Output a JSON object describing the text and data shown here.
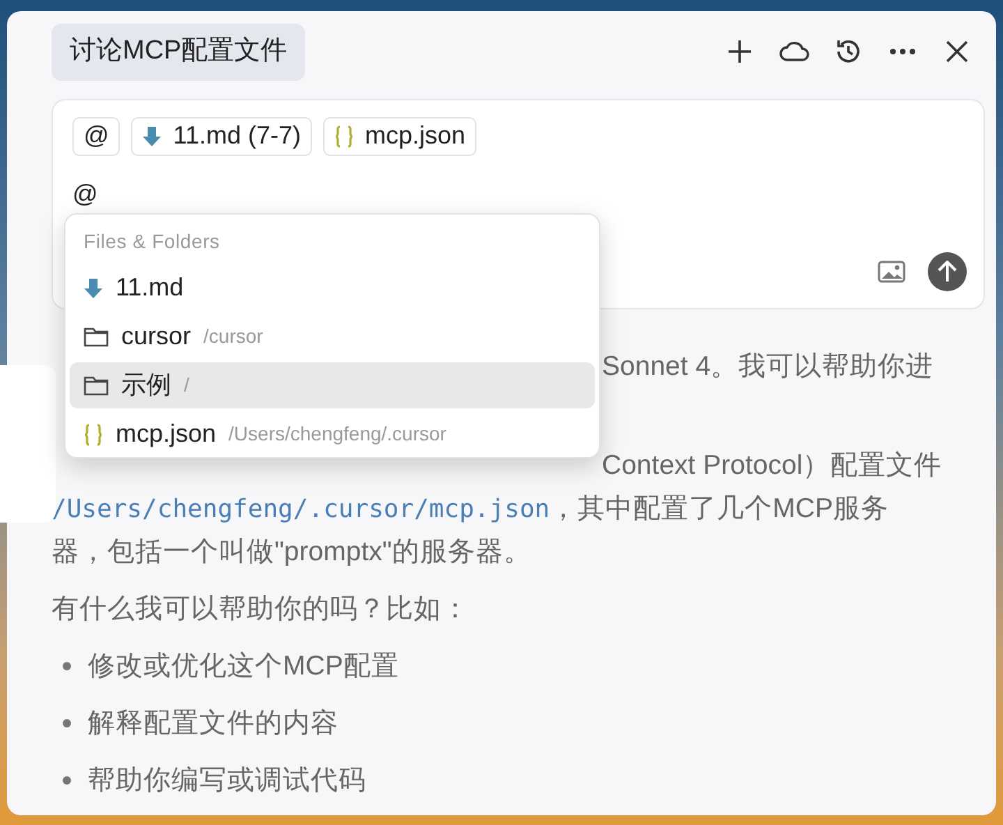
{
  "header": {
    "title": "讨论MCP配置文件"
  },
  "composer": {
    "mention_button": "@",
    "chips": [
      {
        "kind": "markdown",
        "label": "11.md (7-7)"
      },
      {
        "kind": "json",
        "label": "mcp.json"
      }
    ],
    "typed": "@"
  },
  "dropdown": {
    "heading": "Files & Folders",
    "items": [
      {
        "kind": "markdown",
        "name": "11.md",
        "selected": false
      },
      {
        "kind": "folder",
        "name": "cursor",
        "path": "/cursor",
        "selected": false
      },
      {
        "kind": "folder",
        "name": "示例",
        "path": "/",
        "selected": true
      },
      {
        "kind": "json",
        "name": "mcp.json",
        "path": "/Users/chengfeng/.cursor",
        "selected": false
      }
    ]
  },
  "message": {
    "fragments": [
      "Sonnet 4。我可以帮助你进",
      "Context Protocol）配置文件"
    ],
    "paragraph": {
      "code": "/Users/chengfeng/.cursor/mcp.json",
      "text": "，其中配置了几个MCP服务器，包括一个叫做\"promptx\"的服务器。"
    },
    "question": "有什么我可以帮助你的吗？比如：",
    "bullets": [
      "修改或优化这个MCP配置",
      "解释配置文件的内容",
      "帮助你编写或调试代码"
    ]
  }
}
